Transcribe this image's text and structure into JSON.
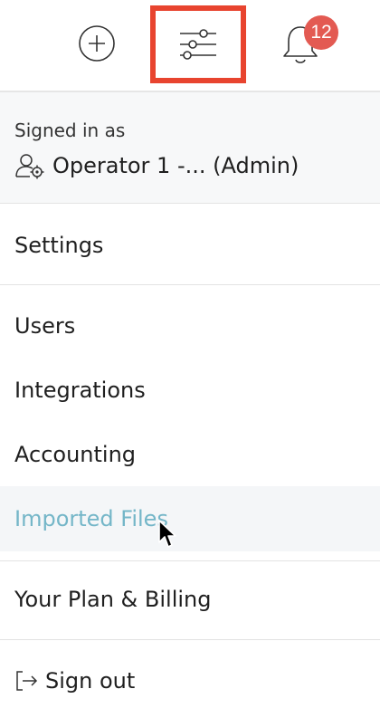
{
  "toolbar": {
    "add_icon": "plus-circle-icon",
    "settings_icon": "sliders-icon",
    "notification_icon": "bell-icon",
    "notification_count": "12",
    "highlight_color": "#e8442f",
    "badge_color": "#e35a52"
  },
  "account": {
    "signed_in_label": "Signed in as",
    "user_icon": "user-gear-icon",
    "user_name": "Operator 1 -... (Admin)"
  },
  "menu": {
    "settings": "Settings",
    "users": "Users",
    "integrations": "Integrations",
    "accounting": "Accounting",
    "imported_files": "Imported Files",
    "plan_billing": "Your Plan & Billing",
    "sign_out": "Sign out",
    "sign_out_icon": "sign-out-icon",
    "hover_color": "#74b6c8"
  }
}
